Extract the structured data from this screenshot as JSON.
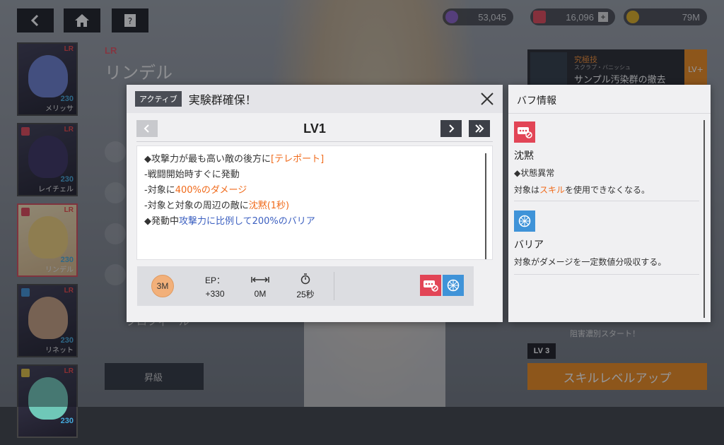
{
  "top": {
    "currencies": [
      {
        "icon": "crystal-icon",
        "value": "53,045"
      },
      {
        "icon": "gem-icon",
        "value": "16,096"
      },
      {
        "icon": "gold-coin-icon",
        "value": "79M"
      }
    ]
  },
  "roster": [
    {
      "name": "メリッサ",
      "level": "230",
      "rank": "LR",
      "color": "#6a7fd0"
    },
    {
      "name": "レイチェル",
      "level": "230",
      "rank": "LR",
      "color": "#3a3060"
    },
    {
      "name": "リンデル",
      "level": "230",
      "rank": "LR",
      "color": "#f2d27a"
    },
    {
      "name": "リネット",
      "level": "230",
      "rank": "LR",
      "color": "#c8a080"
    },
    {
      "name": "",
      "level": "230",
      "rank": "LR",
      "color": "#6fc8b8"
    }
  ],
  "character": {
    "rank": "LR",
    "name": "リンデル"
  },
  "left_menu": {
    "profile": "プロフィール",
    "upgrade": "昇級"
  },
  "ultimate": {
    "tag": "究極技",
    "sub": "スクラプ・バニッシュ",
    "name": "サンプル汚染群の撤去",
    "lvplus": "LV+"
  },
  "behind": {
    "lv3": "LV 3",
    "quote": "阻害濃別スタート！"
  },
  "skill_up_button": "スキルレベルアップ",
  "skill_modal": {
    "type": "アクティブ",
    "title": "実験群確保！",
    "level": "LV1",
    "description": [
      [
        {
          "t": "◆攻撃力が最も高い敵の後方に",
          "c": ""
        },
        {
          "t": "[テレポート]",
          "c": "o"
        }
      ],
      [
        {
          "t": "-戦闘開始時すぐに発動",
          "c": ""
        }
      ],
      [
        {
          "t": "-対象に",
          "c": ""
        },
        {
          "t": "400%のダメージ",
          "c": "o"
        }
      ],
      [
        {
          "t": "-対象と対象の周辺の敵に",
          "c": ""
        },
        {
          "t": "沈黙(1秒)",
          "c": "o"
        }
      ],
      [
        {
          "t": "◆発動中",
          "c": ""
        },
        {
          "t": "攻撃力に比例して200%のバリア",
          "c": "b"
        }
      ]
    ],
    "cost": "3M",
    "stats": [
      {
        "label": "EP：",
        "value": "+330",
        "icon": ""
      },
      {
        "label": "",
        "value": "0M",
        "icon": "range-icon"
      },
      {
        "label": "",
        "value": "25秒",
        "icon": "cooldown-timer-icon"
      }
    ]
  },
  "buff_panel": {
    "title": "バフ情報",
    "items": [
      {
        "icon": "silence-icon",
        "color": "#e24556",
        "name": "沈黙",
        "desc1": "◆状態異常",
        "desc2_pre": "対象は",
        "desc2_hl": "スキル",
        "desc2_post": "を使用できなくなる。"
      },
      {
        "icon": "barrier-icon",
        "color": "#3f93d8",
        "name": "バリア",
        "desc1": "対象がダメージを一定数値分吸収する。"
      }
    ]
  }
}
